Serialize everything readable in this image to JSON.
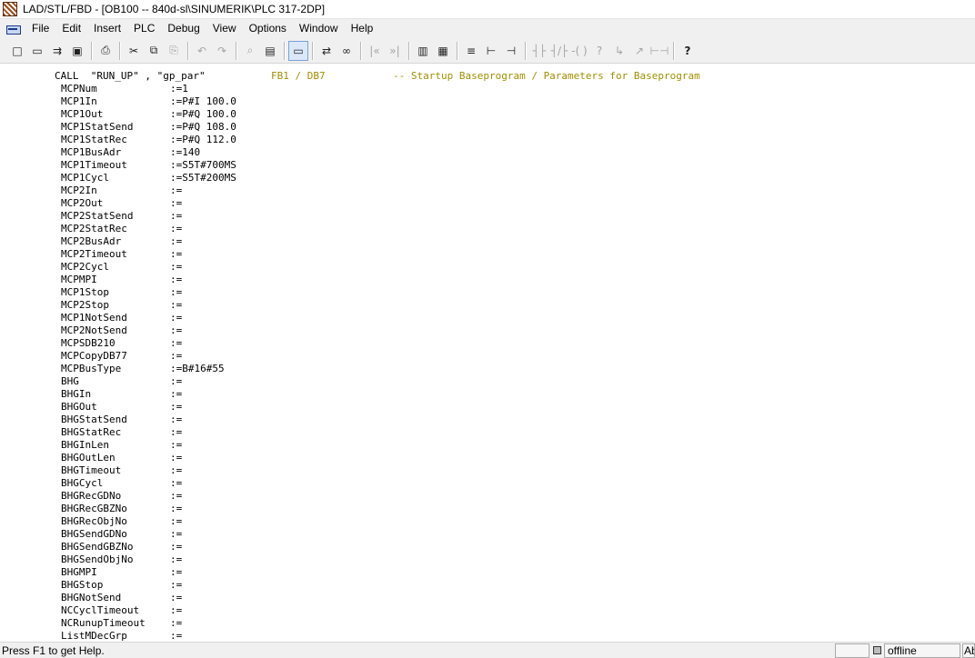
{
  "window": {
    "title": "LAD/STL/FBD - [OB100 -- 840d-sl\\SINUMERIK\\PLC 317-2DP]",
    "icon": "lad-stl-fbd-app-icon"
  },
  "menu": {
    "doc_icon": "document-window-icon",
    "items": [
      "File",
      "Edit",
      "Insert",
      "PLC",
      "Debug",
      "View",
      "Options",
      "Window",
      "Help"
    ]
  },
  "toolbar": {
    "new": "□",
    "open": "▭",
    "download": "⇉",
    "save": "▣",
    "print": "⎙",
    "cut": "✂",
    "copy": "⧉",
    "paste": "⎘",
    "undo": "↶",
    "redo": "↷",
    "find": "⌕",
    "monitor": "▤",
    "module_state": "▭",
    "access_nodes": "⇄",
    "glasses": "∞",
    "prev_network": "|«",
    "next_network": "»|",
    "overview": "▥",
    "details": "▦",
    "new_network": "≡",
    "branch_open": "⊢",
    "branch_close": "⊣",
    "no_contact": "┤├",
    "nc_contact": "┤/├",
    "coil": "-( )",
    "empty_box": "?",
    "open_branch_arrow": "↳",
    "close_branch_arrow": "↗",
    "connection": "⊢⊣",
    "help": "?"
  },
  "code": {
    "call_keyword": "CALL  \"RUN_UP\" , \"gp_par\"",
    "call_fb": "FB1 / DB7",
    "call_comment": "-- Startup Baseprogram / Parameters for Baseprogram",
    "params": [
      {
        "name": "MCPNum",
        "value": ":=1"
      },
      {
        "name": "MCP1In",
        "value": ":=P#I 100.0"
      },
      {
        "name": "MCP1Out",
        "value": ":=P#Q 100.0"
      },
      {
        "name": "MCP1StatSend",
        "value": ":=P#Q 108.0"
      },
      {
        "name": "MCP1StatRec",
        "value": ":=P#Q 112.0"
      },
      {
        "name": "MCP1BusAdr",
        "value": ":=140"
      },
      {
        "name": "MCP1Timeout",
        "value": ":=S5T#700MS"
      },
      {
        "name": "MCP1Cycl",
        "value": ":=S5T#200MS"
      },
      {
        "name": "MCP2In",
        "value": ":="
      },
      {
        "name": "MCP2Out",
        "value": ":="
      },
      {
        "name": "MCP2StatSend",
        "value": ":="
      },
      {
        "name": "MCP2StatRec",
        "value": ":="
      },
      {
        "name": "MCP2BusAdr",
        "value": ":="
      },
      {
        "name": "MCP2Timeout",
        "value": ":="
      },
      {
        "name": "MCP2Cycl",
        "value": ":="
      },
      {
        "name": "MCPMPI",
        "value": ":="
      },
      {
        "name": "MCP1Stop",
        "value": ":="
      },
      {
        "name": "MCP2Stop",
        "value": ":="
      },
      {
        "name": "MCP1NotSend",
        "value": ":="
      },
      {
        "name": "MCP2NotSend",
        "value": ":="
      },
      {
        "name": "MCPSDB210",
        "value": ":="
      },
      {
        "name": "MCPCopyDB77",
        "value": ":="
      },
      {
        "name": "MCPBusType",
        "value": ":=B#16#55"
      },
      {
        "name": "BHG",
        "value": ":="
      },
      {
        "name": "BHGIn",
        "value": ":="
      },
      {
        "name": "BHGOut",
        "value": ":="
      },
      {
        "name": "BHGStatSend",
        "value": ":="
      },
      {
        "name": "BHGStatRec",
        "value": ":="
      },
      {
        "name": "BHGInLen",
        "value": ":="
      },
      {
        "name": "BHGOutLen",
        "value": ":="
      },
      {
        "name": "BHGTimeout",
        "value": ":="
      },
      {
        "name": "BHGCycl",
        "value": ":="
      },
      {
        "name": "BHGRecGDNo",
        "value": ":="
      },
      {
        "name": "BHGRecGBZNo",
        "value": ":="
      },
      {
        "name": "BHGRecObjNo",
        "value": ":="
      },
      {
        "name": "BHGSendGDNo",
        "value": ":="
      },
      {
        "name": "BHGSendGBZNo",
        "value": ":="
      },
      {
        "name": "BHGSendObjNo",
        "value": ":="
      },
      {
        "name": "BHGMPI",
        "value": ":="
      },
      {
        "name": "BHGStop",
        "value": ":="
      },
      {
        "name": "BHGNotSend",
        "value": ":="
      },
      {
        "name": "NCCyclTimeout",
        "value": ":="
      },
      {
        "name": "NCRunupTimeout",
        "value": ":="
      },
      {
        "name": "ListMDecGrp",
        "value": ":="
      }
    ],
    "colors": {
      "comment": "#a09000",
      "text": "#000000"
    }
  },
  "status": {
    "help": "Press F1 to get Help.",
    "mode": "offline",
    "insert": "Ab",
    "net_icon": "network-icon"
  }
}
